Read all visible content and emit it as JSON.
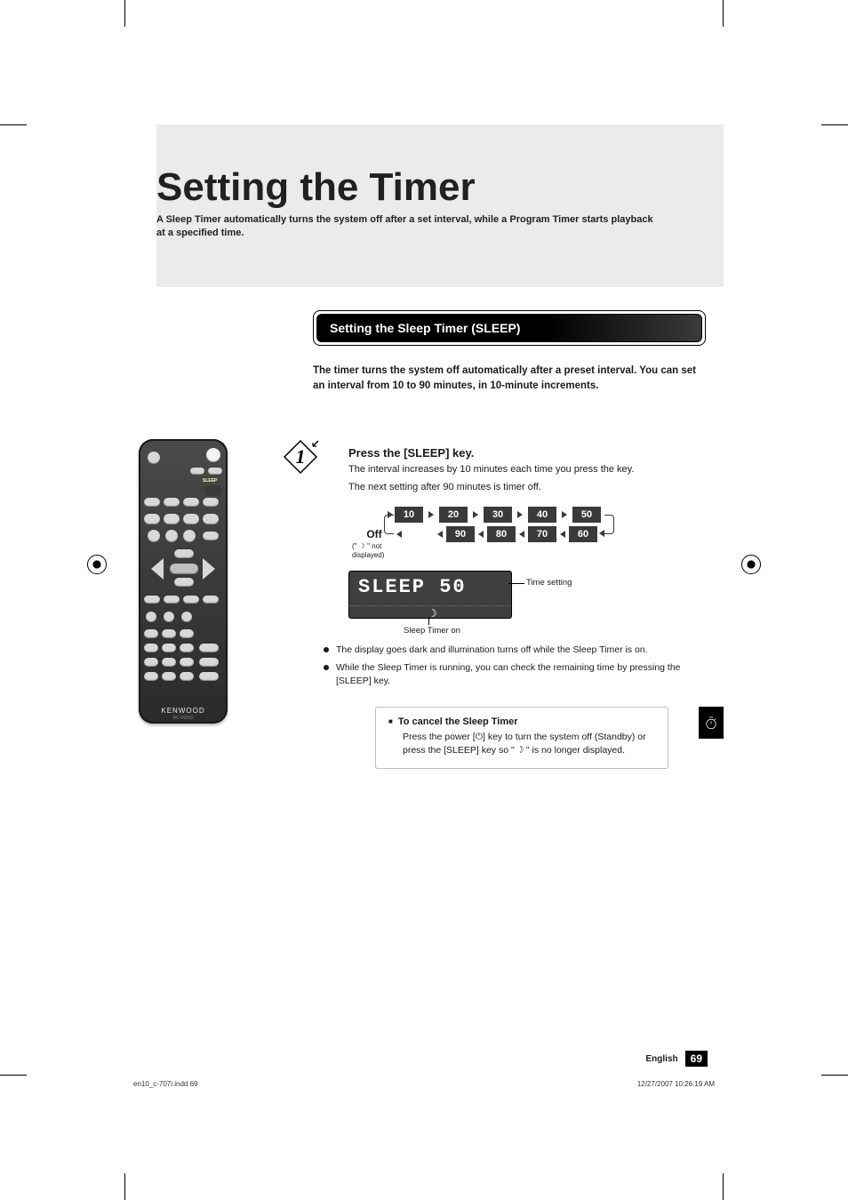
{
  "title": "Setting the Timer",
  "subtitle": "A Sleep Timer automatically turns the system off after a set interval, while a Program Timer starts playback at a specified time.",
  "section_heading": "Setting the Sleep Timer (SLEEP)",
  "section_intro": "The timer turns the system off automatically after a preset interval. You can set an interval from 10 to 90 minutes, in 10-minute increments.",
  "step1": {
    "number": "1",
    "heading": "Press the [SLEEP] key.",
    "line1": "The interval increases by 10 minutes each time you press the key.",
    "line2": "The next setting after 90 minutes is timer off."
  },
  "cycle": {
    "top": [
      "10",
      "20",
      "30",
      "40",
      "50"
    ],
    "bottom": [
      "90",
      "80",
      "70",
      "60"
    ],
    "off_label": "Off",
    "off_note": "(\" ☽ \" not displayed)"
  },
  "display": {
    "text": "SLEEP  50",
    "callout_time": "Time setting",
    "callout_on": "Sleep Timer on"
  },
  "bullets": [
    "The display goes dark and illumination turns off while the Sleep Timer is on.",
    "While the Sleep Timer is running, you can check the remaining time by pressing the [SLEEP] key."
  ],
  "cancel": {
    "heading": "To cancel the Sleep Timer",
    "body": "Press the power [⏻] key to turn the system off (Standby) or press the [SLEEP] key so \" ☽ \" is no longer displayed."
  },
  "remote": {
    "brand": "KENWOOD",
    "model": "RC-F0510",
    "sleep_label": "SLEEP"
  },
  "footer": {
    "language": "English",
    "page_number": "69"
  },
  "imprint": {
    "left": "en10_c-707i.indd   69",
    "right": "12/27/2007   10:26:19 AM"
  }
}
